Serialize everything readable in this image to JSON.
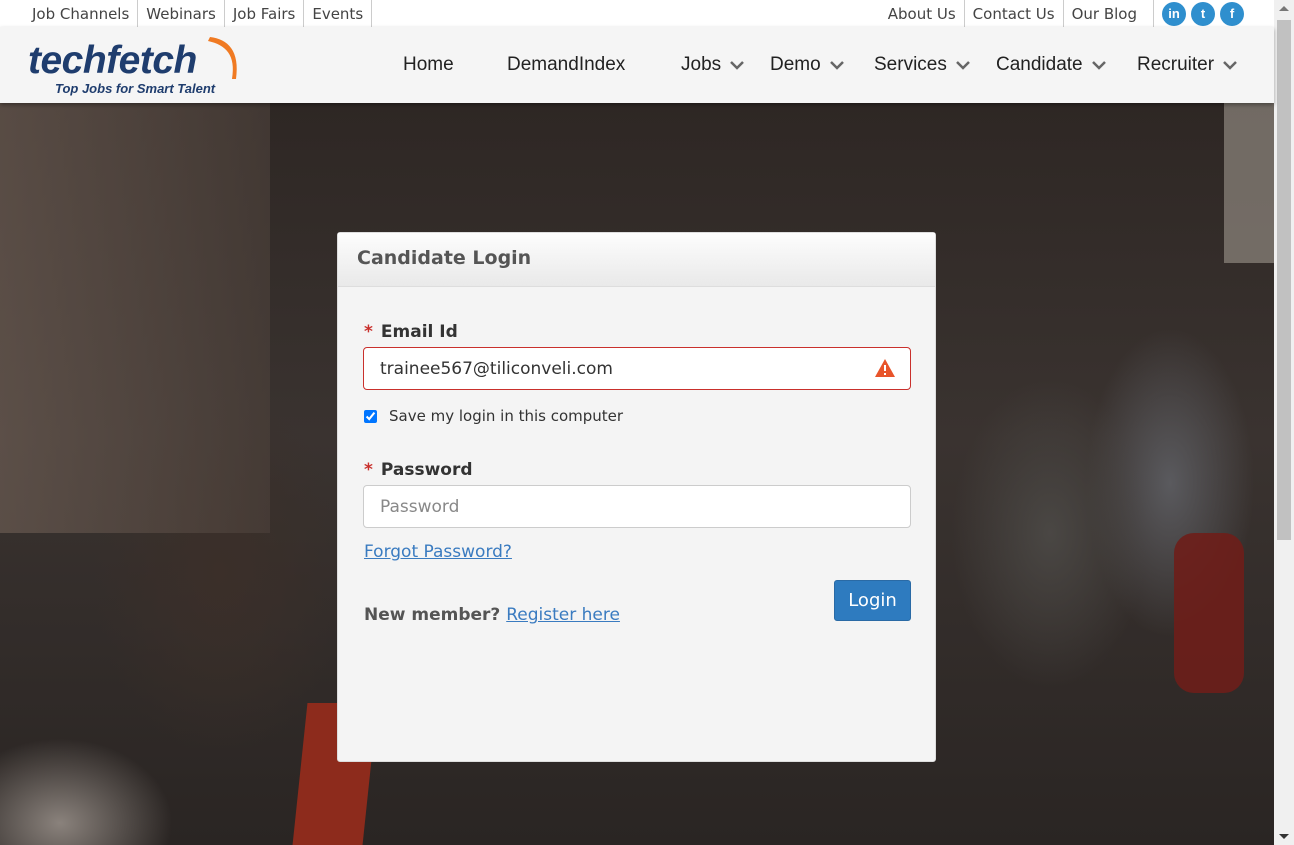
{
  "topbar": {
    "left_links": [
      "Job Channels",
      "Webinars",
      "Job Fairs",
      "Events"
    ],
    "right_links": [
      "About Us",
      "Contact Us",
      "Our Blog"
    ],
    "social": [
      {
        "icon": "linkedin-icon",
        "glyph": "in"
      },
      {
        "icon": "twitter-icon",
        "glyph": "t"
      },
      {
        "icon": "facebook-icon",
        "glyph": "f"
      }
    ]
  },
  "header": {
    "logo_text": "techfetch",
    "logo_tagline": "Top Jobs for Smart Talent",
    "nav": [
      "Home",
      "DemandIndex",
      "Jobs",
      "Demo",
      "Services",
      "Candidate",
      "Recruiter"
    ]
  },
  "login": {
    "title": "Candidate Login",
    "required_mark": "*",
    "email_label": "Email Id",
    "email_value": "trainee567@tiliconveli.com",
    "remember_label": "Save my login in this computer",
    "remember_checked": true,
    "password_label": "Password",
    "password_placeholder": "Password",
    "forgot_label": "Forgot Password?",
    "new_member_label": "New member?",
    "register_label": "Register here",
    "login_button": "Login"
  },
  "colors": {
    "brand_navy": "#1f3d6e",
    "brand_orange": "#f07a22",
    "primary_button": "#2e7bbf",
    "error_red": "#c9302c",
    "link_blue": "#3a7bc0"
  }
}
